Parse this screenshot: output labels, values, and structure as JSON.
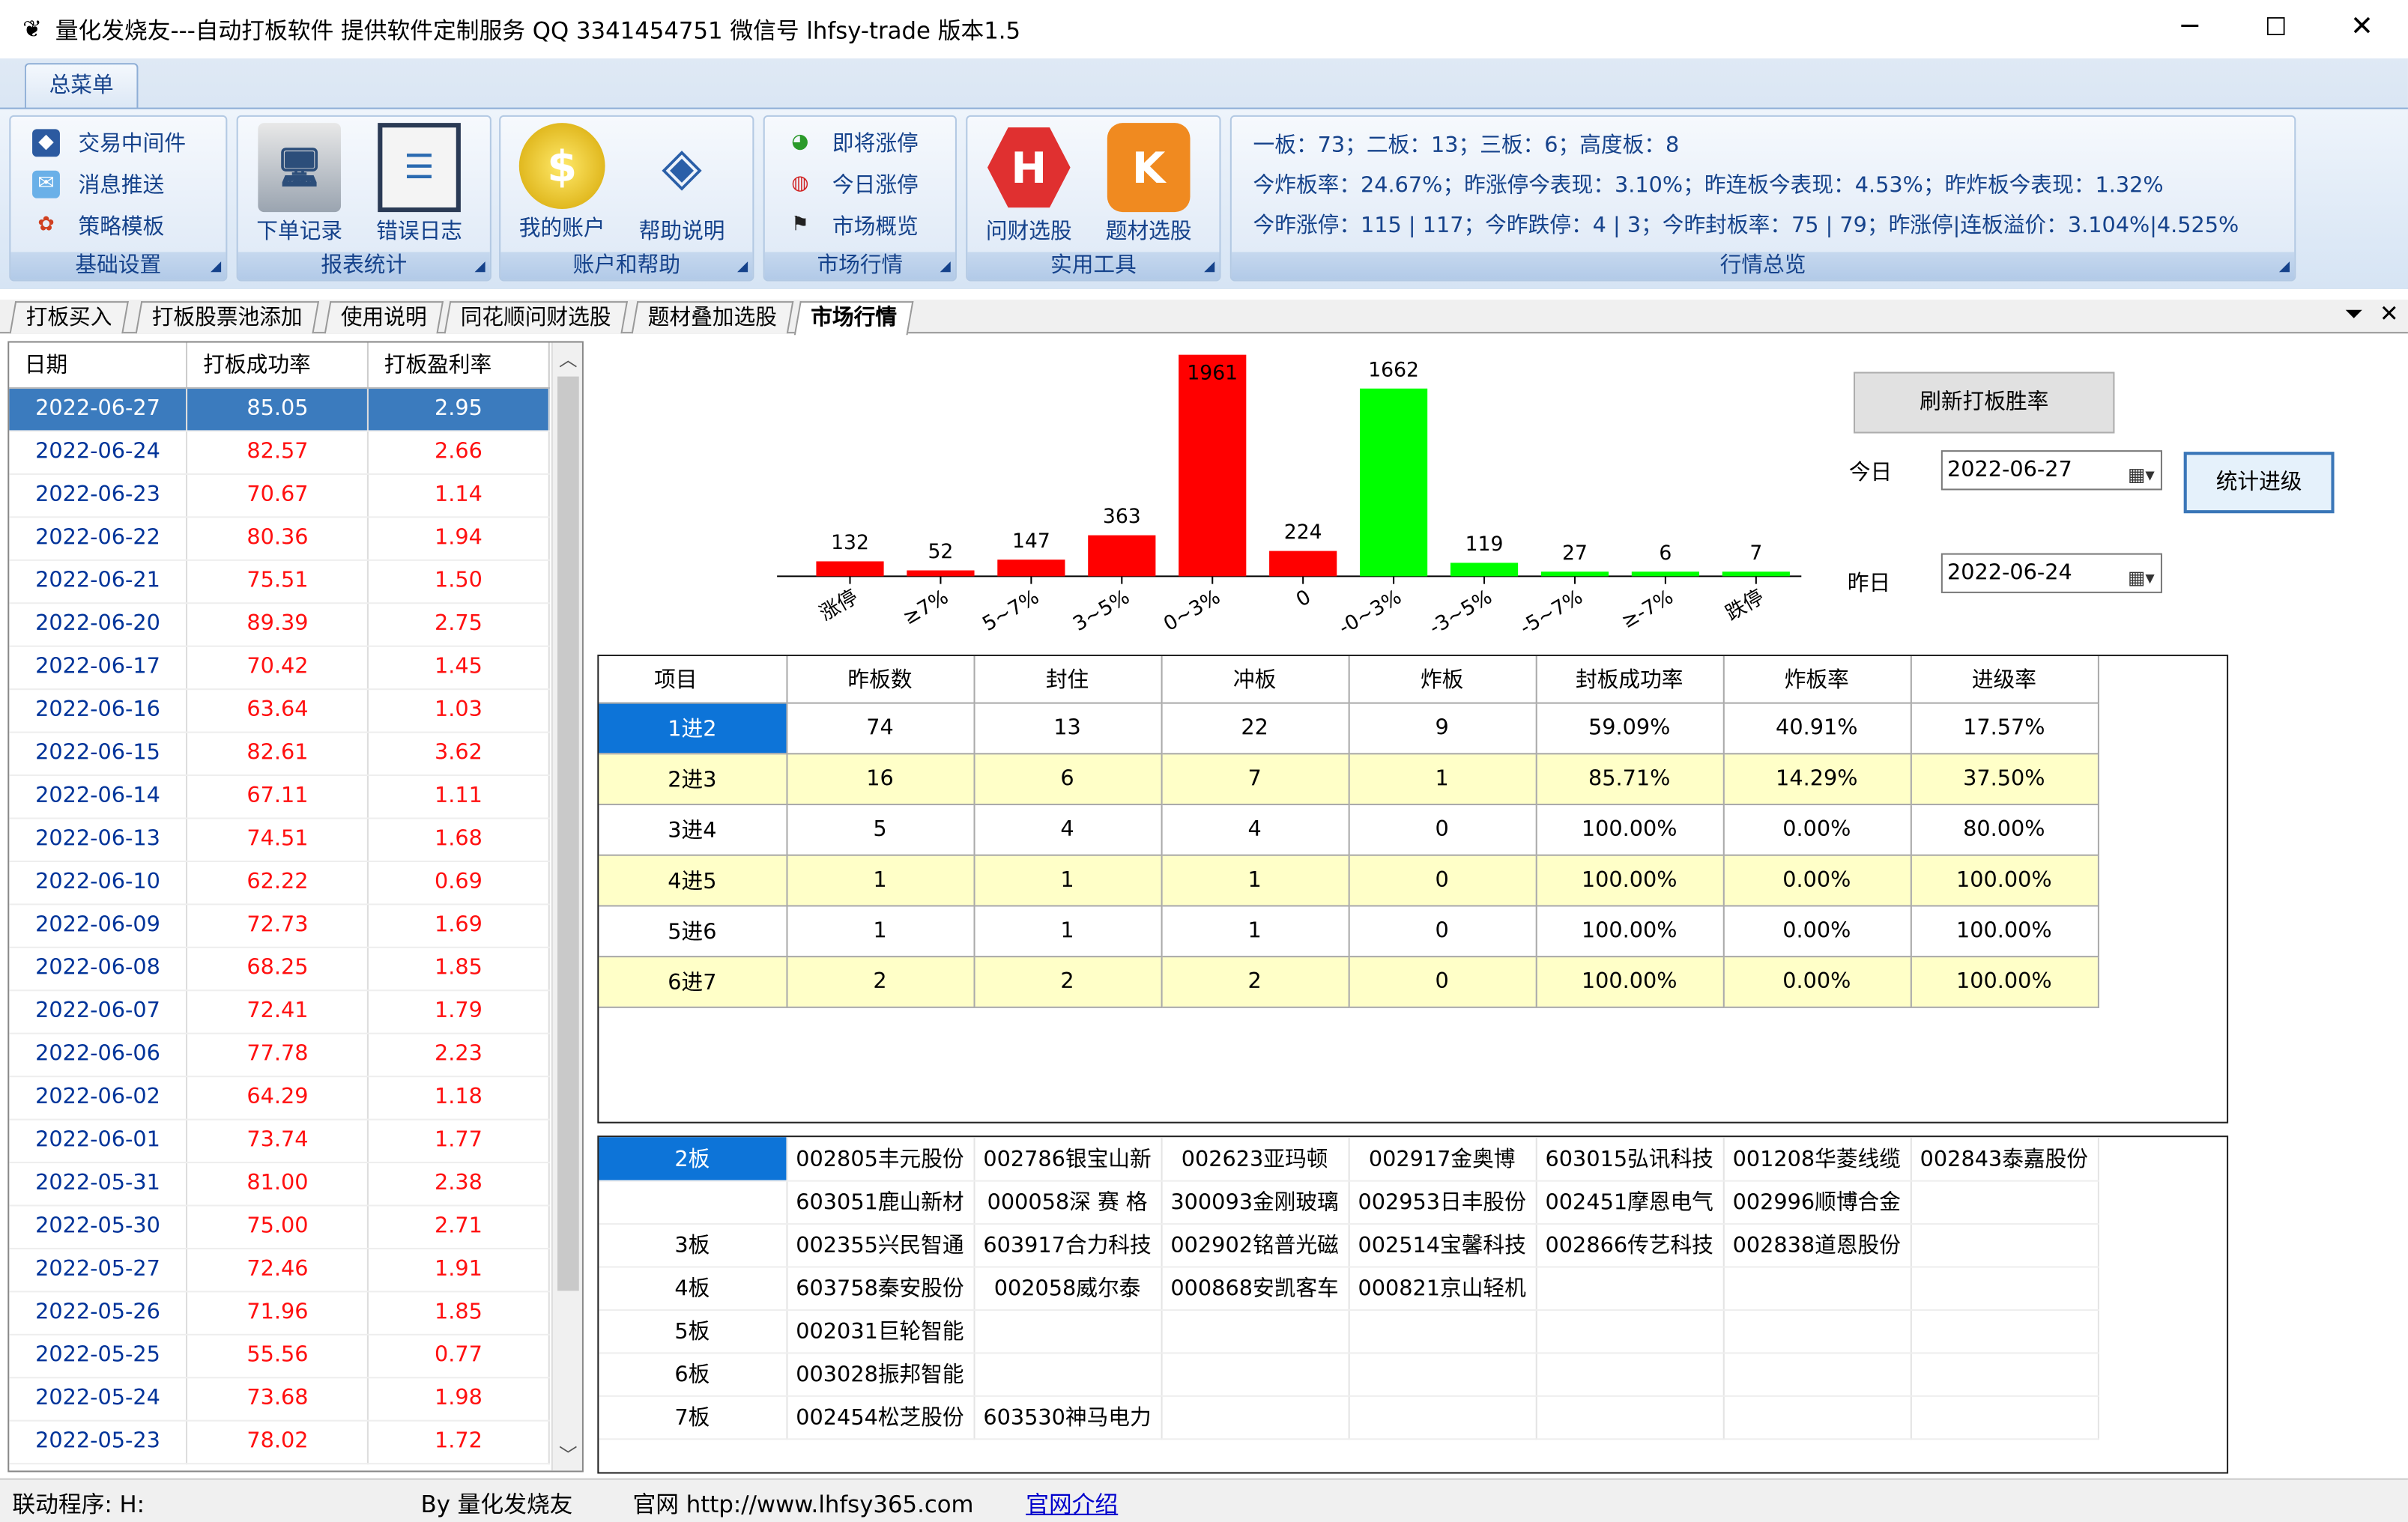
{
  "window": {
    "title": "量化发烧友---自动打板软件 提供软件定制服务 QQ 3341454751 微信号 lhfsy-trade  版本1.5",
    "minimize": "─",
    "maximize": "☐",
    "close": "✕"
  },
  "ribbon": {
    "menu_tab": "总菜单",
    "groups": {
      "basic": {
        "label": "基础设置",
        "items": [
          "交易中间件",
          "消息推送",
          "策略模板"
        ]
      },
      "report": {
        "label": "报表统计",
        "items": [
          "下单记录",
          "错误日志"
        ]
      },
      "account": {
        "label": "账户和帮助",
        "items": [
          "我的账户",
          "帮助说明"
        ]
      },
      "market": {
        "label": "市场行情",
        "items": [
          "即将涨停",
          "今日涨停",
          "市场概览"
        ]
      },
      "tools": {
        "label": "实用工具",
        "items": [
          "问财选股",
          "题材选股"
        ]
      },
      "overview": {
        "label": "行情总览",
        "lines": [
          "一板：73；二板：13；三板：6；高度板：8",
          "今炸板率：24.67%；昨涨停今表现：3.10%；昨连板今表现：4.53%；昨炸板今表现：1.32%",
          "今昨涨停：115 | 117；今昨跌停：4 | 3；今昨封板率：75 | 79；昨涨停|连板溢价：3.104%|4.525%"
        ]
      }
    }
  },
  "tabs": [
    "打板买入",
    "打板股票池添加",
    "使用说明",
    "同花顺问财选股",
    "题材叠加选股",
    "市场行情"
  ],
  "active_tab": "市场行情",
  "left_table": {
    "headers": [
      "日期",
      "打板成功率",
      "打板盈利率"
    ],
    "rows": [
      [
        "2022-06-27",
        "85.05",
        "2.95"
      ],
      [
        "2022-06-24",
        "82.57",
        "2.66"
      ],
      [
        "2022-06-23",
        "70.67",
        "1.14"
      ],
      [
        "2022-06-22",
        "80.36",
        "1.94"
      ],
      [
        "2022-06-21",
        "75.51",
        "1.50"
      ],
      [
        "2022-06-20",
        "89.39",
        "2.75"
      ],
      [
        "2022-06-17",
        "70.42",
        "1.45"
      ],
      [
        "2022-06-16",
        "63.64",
        "1.03"
      ],
      [
        "2022-06-15",
        "82.61",
        "3.62"
      ],
      [
        "2022-06-14",
        "67.11",
        "1.11"
      ],
      [
        "2022-06-13",
        "74.51",
        "1.68"
      ],
      [
        "2022-06-10",
        "62.22",
        "0.69"
      ],
      [
        "2022-06-09",
        "72.73",
        "1.69"
      ],
      [
        "2022-06-08",
        "68.25",
        "1.85"
      ],
      [
        "2022-06-07",
        "72.41",
        "1.79"
      ],
      [
        "2022-06-06",
        "77.78",
        "2.23"
      ],
      [
        "2022-06-02",
        "64.29",
        "1.18"
      ],
      [
        "2022-06-01",
        "73.74",
        "1.77"
      ],
      [
        "2022-05-31",
        "81.00",
        "2.38"
      ],
      [
        "2022-05-30",
        "75.00",
        "2.71"
      ],
      [
        "2022-05-27",
        "72.46",
        "1.91"
      ],
      [
        "2022-05-26",
        "71.96",
        "1.85"
      ],
      [
        "2022-05-25",
        "55.56",
        "0.77"
      ],
      [
        "2022-05-24",
        "73.68",
        "1.98"
      ],
      [
        "2022-05-23",
        "78.02",
        "1.72"
      ]
    ]
  },
  "chart_data": {
    "type": "bar",
    "categories": [
      "涨停",
      "≥7%",
      "5~7%",
      "3~5%",
      "0~3%",
      "0",
      "-0~3%",
      "-3~5%",
      "-5~7%",
      "≥-7%",
      "跌停"
    ],
    "values": [
      132,
      52,
      147,
      363,
      1961,
      224,
      1662,
      119,
      27,
      6,
      7
    ],
    "colors": [
      "#ff0000",
      "#ff0000",
      "#ff0000",
      "#ff0000",
      "#ff0000",
      "#ff0000",
      "#00ff00",
      "#00ff00",
      "#00ff00",
      "#00ff00",
      "#00ff00"
    ],
    "ylim": [
      0,
      2000
    ],
    "grid": false
  },
  "controls": {
    "refresh_label": "刷新打板胜率",
    "today_label": "今日",
    "today_value": "2022-06-27",
    "yesterday_label": "昨日",
    "yesterday_value": "2022-06-24",
    "stat_label": "统计进级"
  },
  "promo_table": {
    "headers": [
      "项目",
      "昨板数",
      "封住",
      "冲板",
      "炸板",
      "封板成功率",
      "炸板率",
      "进级率"
    ],
    "rows": [
      [
        "1进2",
        "74",
        "13",
        "22",
        "9",
        "59.09%",
        "40.91%",
        "17.57%"
      ],
      [
        "2进3",
        "16",
        "6",
        "7",
        "1",
        "85.71%",
        "14.29%",
        "37.50%"
      ],
      [
        "3进4",
        "5",
        "4",
        "4",
        "0",
        "100.00%",
        "0.00%",
        "80.00%"
      ],
      [
        "4进5",
        "1",
        "1",
        "1",
        "0",
        "100.00%",
        "0.00%",
        "100.00%"
      ],
      [
        "5进6",
        "1",
        "1",
        "1",
        "0",
        "100.00%",
        "0.00%",
        "100.00%"
      ],
      [
        "6进7",
        "2",
        "2",
        "2",
        "0",
        "100.00%",
        "0.00%",
        "100.00%"
      ]
    ]
  },
  "board_grid": {
    "rows": [
      [
        "2板",
        "002805丰元股份",
        "002786银宝山新",
        "002623亚玛顿",
        "002917金奥博",
        "603015弘讯科技",
        "001208华菱线缆",
        "002843泰嘉股份"
      ],
      [
        "",
        "603051鹿山新材",
        "000058深 赛 格",
        "300093金刚玻璃",
        "002953日丰股份",
        "002451摩恩电气",
        "002996顺博合金",
        ""
      ],
      [
        "3板",
        "002355兴民智通",
        "603917合力科技",
        "002902铭普光磁",
        "002514宝馨科技",
        "002866传艺科技",
        "002838道恩股份",
        ""
      ],
      [
        "4板",
        "603758秦安股份",
        "002058威尔泰",
        "000868安凯客车",
        "000821京山轻机",
        "",
        "",
        ""
      ],
      [
        "5板",
        "002031巨轮智能",
        "",
        "",
        "",
        "",
        "",
        ""
      ],
      [
        "6板",
        "003028振邦智能",
        "",
        "",
        "",
        "",
        "",
        ""
      ],
      [
        "7板",
        "002454松芝股份",
        "603530神马电力",
        "",
        "",
        "",
        "",
        ""
      ]
    ]
  },
  "status": {
    "link_prog": "联动程序:  H:",
    "by": "By 量化发烧友",
    "site": "官网 http://www.lhfsy365.com",
    "intro_link": "官网介绍"
  }
}
